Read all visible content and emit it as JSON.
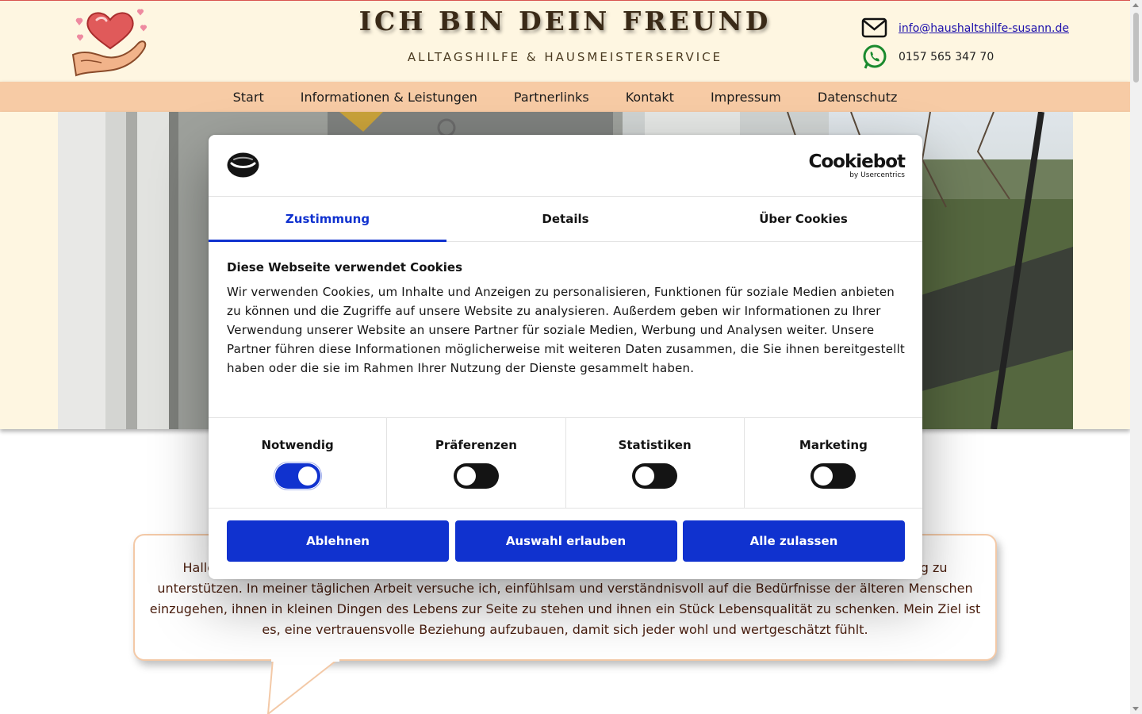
{
  "header": {
    "title": "ICH BIN DEIN FREUND",
    "subtitle": "ALLTAGSHILFE  &  HAUSMEISTERSERVICE",
    "email": "info@haushaltshilfe-susann.de",
    "phone": "0157 565 347 70",
    "logo_icon": "heart-in-hands-logo",
    "email_icon": "envelope-icon",
    "phone_icon": "whatsapp-icon"
  },
  "nav": {
    "items": [
      {
        "label": "Start"
      },
      {
        "label": "Informationen & Leistungen"
      },
      {
        "label": "Partnerlinks"
      },
      {
        "label": "Kontakt"
      },
      {
        "label": "Impressum"
      },
      {
        "label": "Datenschutz"
      }
    ]
  },
  "intro": {
    "text": "Hallo, ich bin Susann und unterstütze ältere Menschen, die Hilfe benötigen. Es ist mir eine Freude, Sie in Ihrem Alltag zu unterstützen. In meiner täglichen Arbeit versuche ich, einfühlsam und verständnisvoll auf die Bedürfnisse der älteren Menschen einzugehen, ihnen in kleinen Dingen des Lebens zur Seite zu stehen und ihnen ein Stück Lebensqualität zu schenken. Mein Ziel ist es, eine vertrauensvolle Beziehung aufzubauen, damit sich jeder wohl und wertgeschätzt fühlt."
  },
  "cookie_dialog": {
    "brand_name": "Cookiebot",
    "brand_by": "by Usercentrics",
    "tabs": [
      {
        "label": "Zustimmung",
        "active": true
      },
      {
        "label": "Details",
        "active": false
      },
      {
        "label": "Über Cookies",
        "active": false
      }
    ],
    "heading": "Diese Webseite verwendet Cookies",
    "body": "Wir verwenden Cookies, um Inhalte und Anzeigen zu personalisieren, Funktionen für soziale Medien anbieten zu können und die Zugriffe auf unsere Website zu analysieren. Außerdem geben wir Informationen zu Ihrer Verwendung unserer Website an unsere Partner für soziale Medien, Werbung und Analysen weiter. Unsere Partner führen diese Informationen möglicherweise mit weiteren Daten zusammen, die Sie ihnen bereitgestellt haben oder die sie im Rahmen Ihrer Nutzung der Dienste gesammelt haben.",
    "toggles": [
      {
        "label": "Notwendig",
        "on": true
      },
      {
        "label": "Präferenzen",
        "on": false
      },
      {
        "label": "Statistiken",
        "on": false
      },
      {
        "label": "Marketing",
        "on": false
      }
    ],
    "buttons": [
      {
        "label": "Ablehnen"
      },
      {
        "label": "Auswahl erlauben"
      },
      {
        "label": "Alle zulassen"
      }
    ]
  },
  "colors": {
    "accent_blue": "#1032cf",
    "header_bg": "#fef6e1",
    "nav_bg": "#f7cba5",
    "text_brown": "#4a1e0e"
  }
}
